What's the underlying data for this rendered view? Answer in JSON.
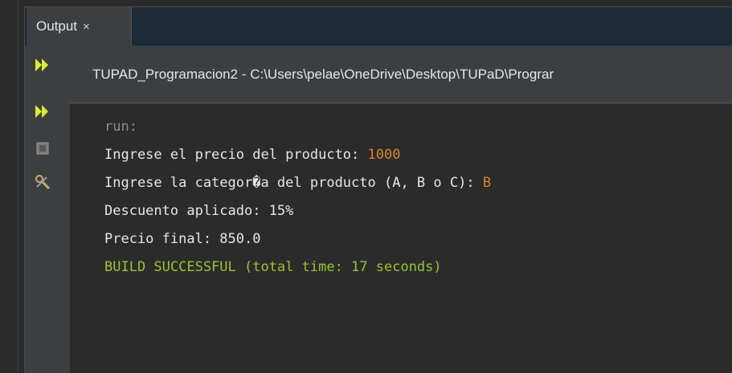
{
  "tab": {
    "label": "Output",
    "close": "×"
  },
  "header": {
    "title": "TUPAD_Programacion2 - C:\\Users\\pelae\\OneDrive\\Desktop\\TUPaD\\Prograr"
  },
  "toolbar": {
    "icons": [
      "rerun-icon",
      "rerun-icon",
      "stop-icon",
      "settings-icon"
    ],
    "colors": {
      "play": "#d6ef2f",
      "stop": "#7a7a7a",
      "settings": "#c8a878"
    }
  },
  "console": {
    "run": "run:",
    "line1_prompt": "Ingrese el precio del producto: ",
    "line1_input": "1000",
    "line2_prompt": "Ingrese la categor�a del producto (A, B o C): ",
    "line2_input": "B",
    "line3": "Descuento aplicado: 15%",
    "line4": "Precio final: 850.0",
    "line5": "BUILD SUCCESSFUL (total time: 17 seconds)"
  },
  "colors": {
    "background": "#2b2b2b",
    "input_text": "#d9822b",
    "success": "#9ac433"
  }
}
